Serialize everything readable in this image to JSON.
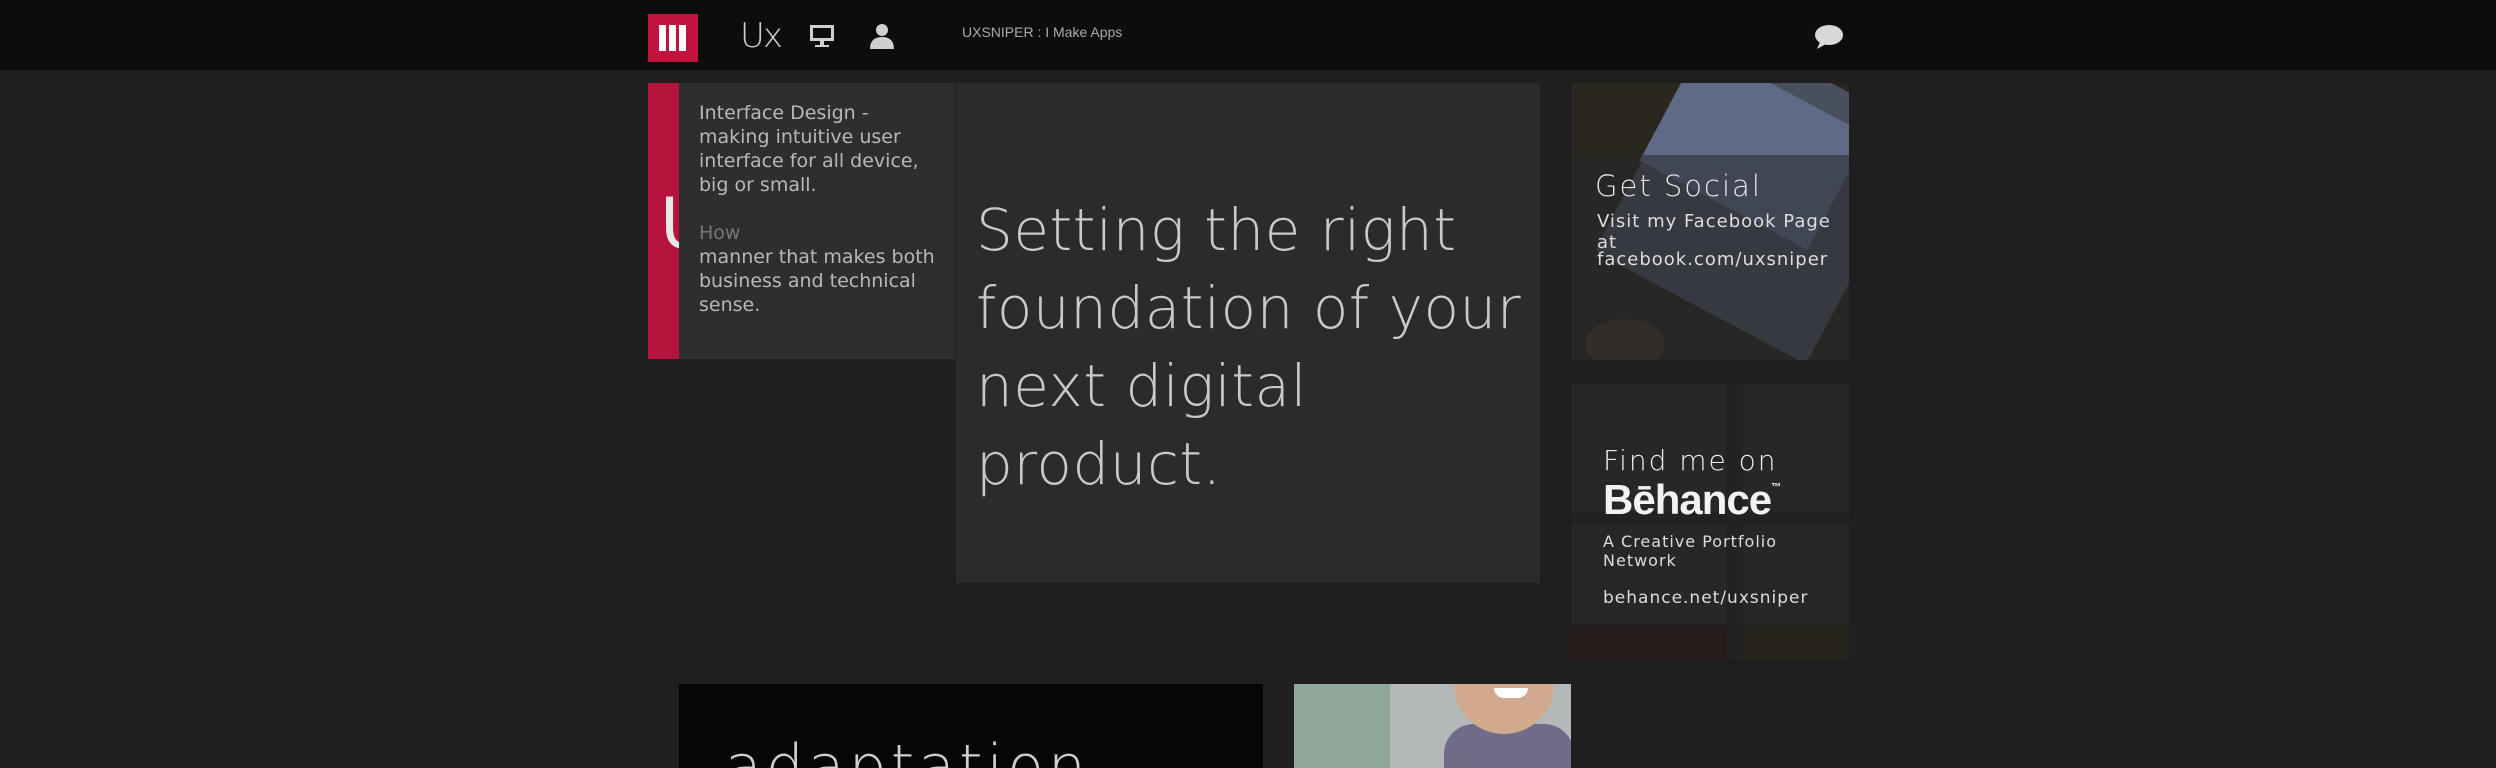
{
  "header": {
    "logo_text": "Ux",
    "site_title": "UXSNIPER : I Make Apps",
    "icons": [
      "menu-icon",
      "desktop-icon",
      "user-icon",
      "chat-icon"
    ]
  },
  "popup": {
    "big_letter": "U",
    "line1": "Interface Design  - making intuitive user interface for all device, big or small.",
    "line2": "How",
    "line3": "manner that makes both business and technical sense."
  },
  "hero": {
    "headline": "Setting the right foundation of your next digital product."
  },
  "social": {
    "title": "Get Social",
    "line1": "Visit my Facebook Page at",
    "line2": "facebook.com/uxsniper"
  },
  "behance": {
    "find": "Find me on",
    "logo": "Bēhance",
    "tm": "™",
    "subtitle": "A Creative Portfolio Network",
    "url": "behance.net/uxsniper"
  },
  "adaptation": {
    "text": "adaptation"
  },
  "colors": {
    "accent": "#c0143c",
    "topbar": "#0d0d0d",
    "background": "#1f1f1f"
  }
}
